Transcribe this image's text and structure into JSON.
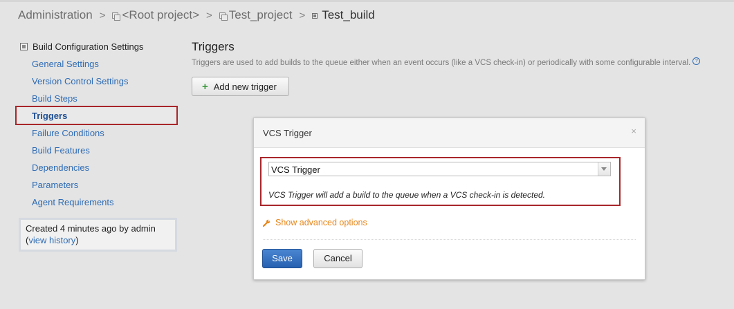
{
  "breadcrumb": {
    "items": [
      "Administration",
      "<Root project>",
      "Test_project",
      "Test_build"
    ],
    "separator": ">"
  },
  "sidebar": {
    "heading": "Build Configuration Settings",
    "items": [
      {
        "label": "General Settings"
      },
      {
        "label": "Version Control Settings"
      },
      {
        "label": "Build Steps"
      },
      {
        "label": "Triggers",
        "active": true
      },
      {
        "label": "Failure Conditions"
      },
      {
        "label": "Build Features"
      },
      {
        "label": "Dependencies"
      },
      {
        "label": "Parameters"
      },
      {
        "label": "Agent Requirements"
      }
    ],
    "info": {
      "created_text": "Created 4 minutes ago  by admin",
      "open_paren": "(",
      "history_link": "view history",
      "close_paren": ")"
    }
  },
  "main": {
    "title": "Triggers",
    "description": "Triggers are used to add builds to the queue either when an event occurs (like a VCS check-in) or periodically with some configurable interval.",
    "help_glyph": "?",
    "add_button_icon": "+",
    "add_button_label": "Add new trigger"
  },
  "dialog": {
    "title": "VCS Trigger",
    "close_glyph": "×",
    "select_value": "VCS Trigger",
    "select_description": "VCS Trigger will add a build to the queue when a VCS check-in is detected.",
    "advanced_link": "Show advanced options",
    "save_label": "Save",
    "cancel_label": "Cancel"
  },
  "colors": {
    "link": "#2d6bb5",
    "highlight_border": "#a8262a",
    "advanced_link": "#e8861a",
    "primary_button": "#2660b0"
  },
  "icons": {
    "project": "project-icon",
    "build_configuration": "build-configuration-icon",
    "help": "help-icon",
    "add": "plus-icon",
    "close": "close-icon",
    "dropdown": "chevron-down-icon",
    "advanced": "wrench-icon"
  }
}
